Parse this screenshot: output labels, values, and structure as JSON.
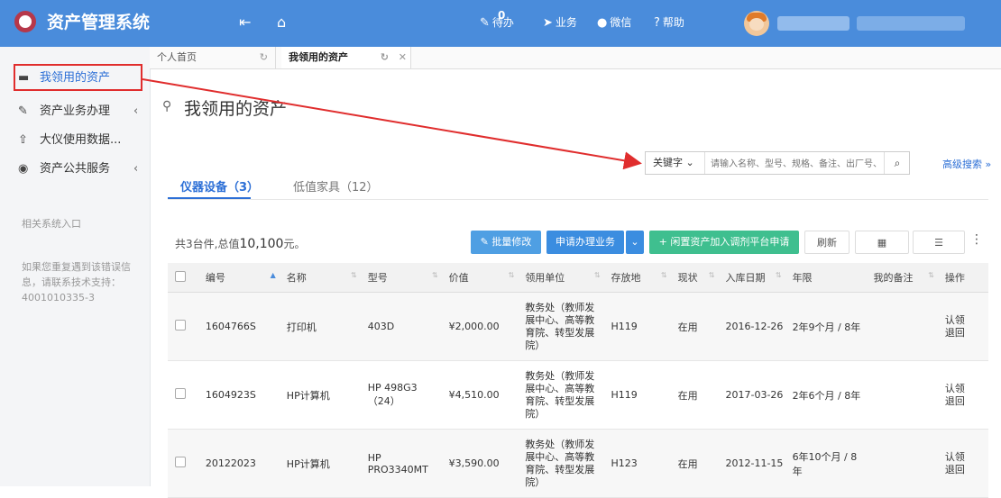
{
  "header": {
    "app_title": "资产管理系统",
    "todo_label": "待办",
    "todo_count": "0",
    "business_label": "业务",
    "wechat_label": "微信",
    "help_label": "帮助"
  },
  "sidebar": {
    "items": [
      {
        "label": "我领用的资产"
      },
      {
        "label": "资产业务办理"
      },
      {
        "label": "大仪使用数据..."
      },
      {
        "label": "资产公共服务"
      }
    ],
    "related_title": "相关系统入口",
    "support_text": "如果您重复遇到该错误信息，请联系技术支持：4001010335-3"
  },
  "page_tabs": [
    {
      "label": "个人首页"
    },
    {
      "label": "我领用的资产"
    }
  ],
  "main": {
    "title": "我领用的资产",
    "search": {
      "key_label": "关键字",
      "placeholder": "请输入名称、型号、规格、备注、出厂号、",
      "advanced_label": "高级搜索"
    },
    "content_tabs": [
      {
        "label": "仪器设备（3）"
      },
      {
        "label": "低值家具（12）"
      }
    ],
    "summary_prefix": "共3台件,总值",
    "summary_value": "10,100",
    "summary_suffix": "元。",
    "toolbar": {
      "batch_edit": "批量修改",
      "apply_business": "申请办理业务",
      "idle_to_platform": "闲置资产加入调剂平台申请",
      "refresh": "刷新"
    }
  },
  "table": {
    "headers": [
      "编号",
      "名称",
      "型号",
      "价值",
      "领用单位",
      "存放地",
      "现状",
      "入库日期",
      "年限",
      "我的备注",
      "操作"
    ],
    "rows": [
      {
        "id": "1604766S",
        "name": "打印机",
        "model": "403D",
        "value": "¥2,000.00",
        "unit": "教务处（教师发展中心、高等教育院、转型发展院）",
        "location": "H119",
        "status": "在用",
        "date": "2016-12-26",
        "years": "2年9个月 / 8年",
        "note": "",
        "action": "认领退回"
      },
      {
        "id": "1604923S",
        "name": "HP计算机",
        "model": "HP 498G3（24）",
        "value": "¥4,510.00",
        "unit": "教务处（教师发展中心、高等教育院、转型发展院）",
        "location": "H119",
        "status": "在用",
        "date": "2017-03-26",
        "years": "2年6个月 / 8年",
        "note": "",
        "action": "认领退回"
      },
      {
        "id": "20122023",
        "name": "HP计算机",
        "model": "HP PRO3340MT",
        "value": "¥3,590.00",
        "unit": "教务处（教师发展中心、高等教育院、转型发展院）",
        "location": "H123",
        "status": "在用",
        "date": "2012-11-15",
        "years": "6年10个月 / 8年",
        "note": "",
        "action": "认领退回"
      }
    ]
  },
  "colors": {
    "header_bg": "#4a8cdb",
    "accent": "#2c6fd6",
    "status_green": "#2aa864",
    "years_red": "#d93a2b",
    "highlight_red": "#e02d2d"
  }
}
